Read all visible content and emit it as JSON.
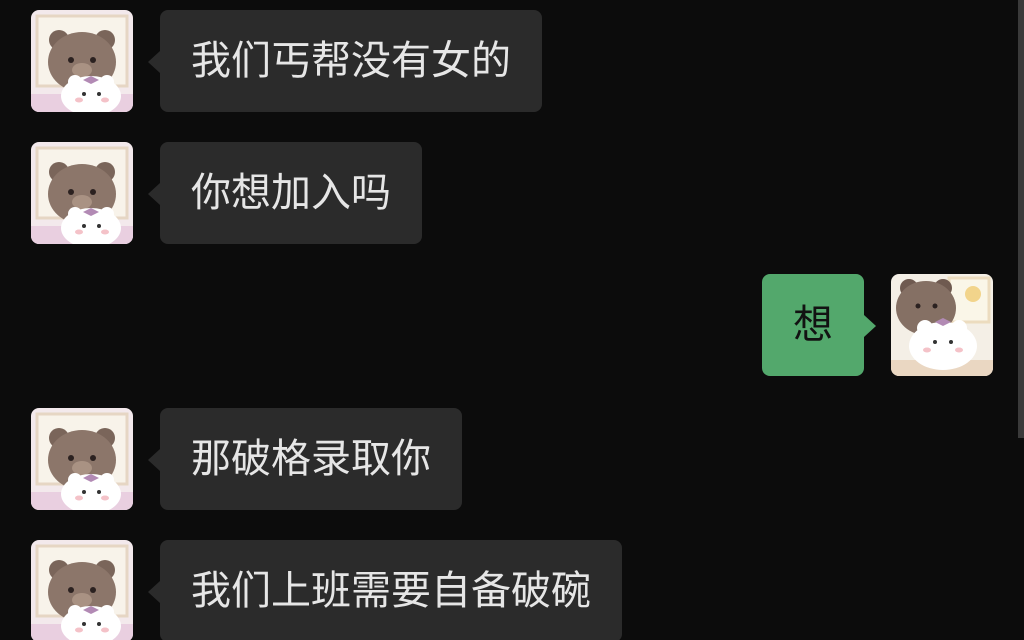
{
  "messages": [
    {
      "side": "left",
      "text": "我们丐帮没有女的",
      "avatar": "bear-cat-avatar-icon"
    },
    {
      "side": "left",
      "text": "你想加入吗",
      "avatar": "bear-cat-avatar-icon"
    },
    {
      "side": "right",
      "text": "想",
      "avatar": "bear-cat-avatar-icon"
    },
    {
      "side": "left",
      "text": "那破格录取你",
      "avatar": "bear-cat-avatar-icon"
    },
    {
      "side": "left",
      "text": "我们上班需要自备破碗",
      "avatar": "bear-cat-avatar-icon"
    }
  ],
  "colors": {
    "background": "#0c0c0c",
    "incoming_bubble": "#2b2b2b",
    "outgoing_bubble": "#53a86c",
    "incoming_text": "#e6e6e6",
    "outgoing_text": "#121212"
  }
}
